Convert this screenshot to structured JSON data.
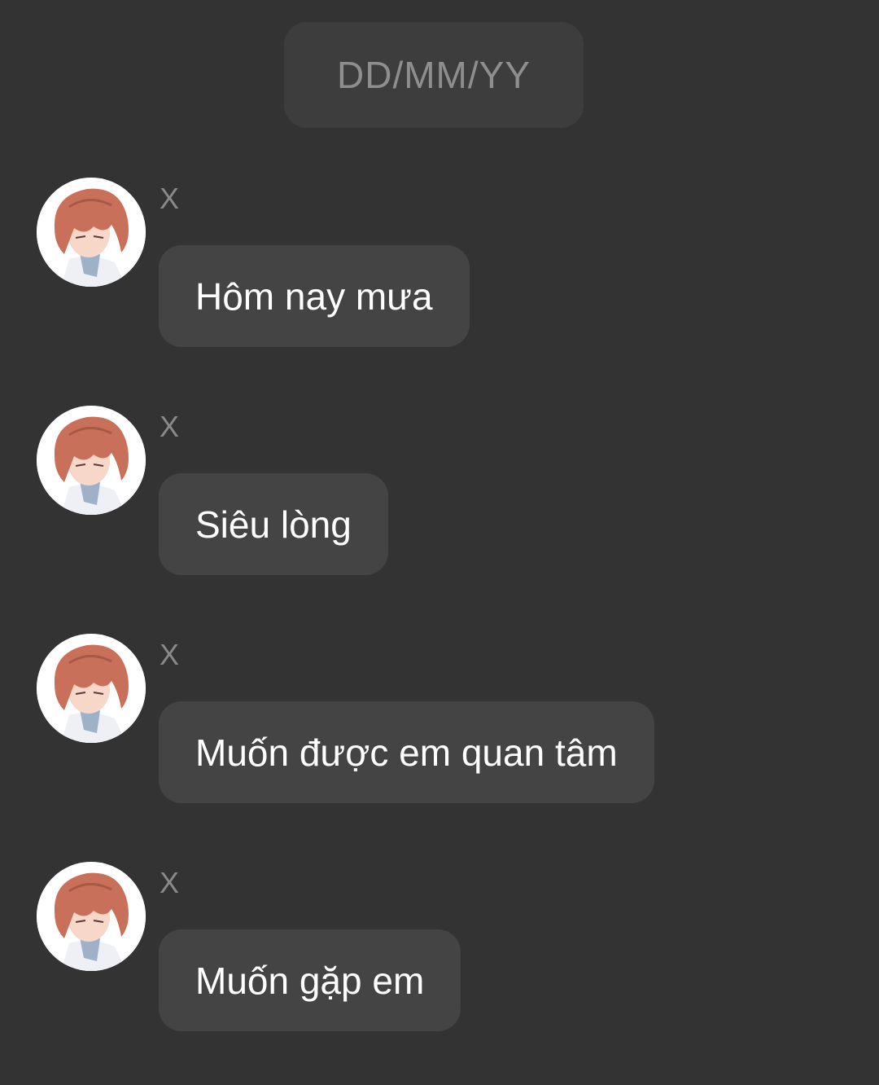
{
  "date_header": "DD/MM/YY",
  "messages": [
    {
      "sender": "X",
      "text": "Hôm nay mưa",
      "avatar_icon": "anime-boy-avatar"
    },
    {
      "sender": "X",
      "text": "Siêu lòng",
      "avatar_icon": "anime-boy-avatar"
    },
    {
      "sender": "X",
      "text": "Muốn được em quan tâm",
      "avatar_icon": "anime-boy-avatar"
    },
    {
      "sender": "X",
      "text": "Muốn gặp em",
      "avatar_icon": "anime-boy-avatar"
    }
  ],
  "colors": {
    "background": "#333333",
    "bubble": "#444444",
    "date_pill": "#3d3d3d",
    "hair": "#c9705a"
  }
}
